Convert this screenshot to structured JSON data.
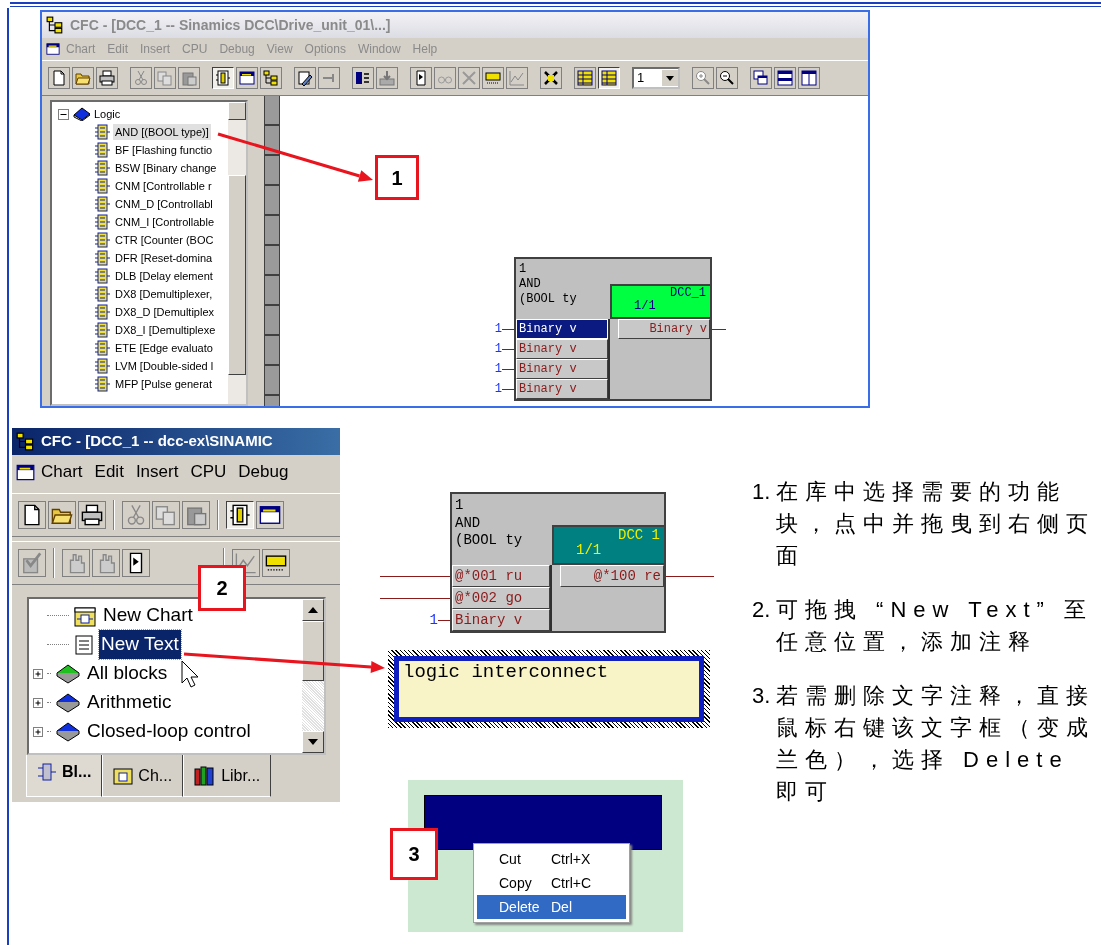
{
  "panel_1": {
    "callout": "1",
    "window": {
      "title": "CFC - [DCC_1 -- Sinamics DCC\\Drive_unit_01\\...]",
      "active": false,
      "menu": [
        "Chart",
        "Edit",
        "Insert",
        "CPU",
        "Debug",
        "View",
        "Options",
        "Window",
        "Help"
      ],
      "sheet_number": "1",
      "tree": {
        "label": "Logic",
        "expanded": true,
        "children": [
          {
            "label": "AND [(BOOL type)]",
            "selected": true
          },
          {
            "label": "BF [Flashing functio",
            "selected": false
          },
          {
            "label": "BSW [Binary change",
            "selected": false
          },
          {
            "label": "CNM [Controllable r",
            "selected": false
          },
          {
            "label": "CNM_D [Controllabl",
            "selected": false
          },
          {
            "label": "CNM_I [Controllable",
            "selected": false
          },
          {
            "label": "CTR [Counter (BOC",
            "selected": false
          },
          {
            "label": "DFR [Reset-domina",
            "selected": false
          },
          {
            "label": "DLB [Delay element",
            "selected": false
          },
          {
            "label": "DX8 [Demultiplexer,",
            "selected": false
          },
          {
            "label": "DX8_D [Demultiplex",
            "selected": false
          },
          {
            "label": "DX8_I [Demultiplexe",
            "selected": false
          },
          {
            "label": "ETE [Edge evaluato",
            "selected": false
          },
          {
            "label": "LVM [Double-sided l",
            "selected": false
          },
          {
            "label": "MFP [Pulse generat",
            "selected": false
          }
        ]
      },
      "block": {
        "number": "1",
        "name": "AND",
        "comment": "(BOOL ty",
        "task": "DCC_1",
        "sequence": "1/1",
        "color": "#00ff40",
        "inputs": [
          {
            "label": "Binary v",
            "kind": "constant",
            "value": "1",
            "selected": true
          },
          {
            "label": "Binary v",
            "kind": "constant",
            "value": "1",
            "selected": false
          },
          {
            "label": "Binary v",
            "kind": "constant",
            "value": "1",
            "selected": false
          },
          {
            "label": "Binary v",
            "kind": "constant",
            "value": "1",
            "selected": false
          }
        ],
        "outputs": [
          {
            "label": "Binary v",
            "kind": "wire",
            "selected": false
          }
        ]
      }
    }
  },
  "panel_2": {
    "callout": "2",
    "window": {
      "title": "CFC - [DCC_1 -- dcc-ex\\SINAMIC",
      "active": true,
      "menu": [
        "Chart",
        "Edit",
        "Insert",
        "CPU",
        "Debug"
      ],
      "tree": [
        {
          "label": "New Chart",
          "kind": "chart",
          "expandable": false,
          "selected": false
        },
        {
          "label": "New Text",
          "kind": "text",
          "expandable": false,
          "selected": true
        },
        {
          "label": "All blocks",
          "kind": "library",
          "color": "#20c020",
          "expandable": true,
          "selected": false
        },
        {
          "label": "Arithmetic",
          "kind": "library",
          "color": "#1030e0",
          "expandable": true,
          "selected": false
        },
        {
          "label": "Closed-loop control",
          "kind": "library",
          "color": "#1030e0",
          "expandable": true,
          "selected": false
        }
      ],
      "tabs": [
        {
          "label": "Bl...",
          "kind": "blocks",
          "selected": true
        },
        {
          "label": "Ch...",
          "kind": "charts",
          "selected": false
        },
        {
          "label": "Libr...",
          "kind": "libraries",
          "selected": false
        }
      ]
    },
    "block": {
      "number": "1",
      "name": "AND",
      "comment": "(BOOL ty",
      "task": "DCC 1",
      "sequence": "1/1",
      "color": "#008080",
      "inputs": [
        {
          "label": "@*001 ru",
          "kind": "wire",
          "selected": false
        },
        {
          "label": "@*002 go",
          "kind": "wire",
          "selected": false
        },
        {
          "label": "Binary v",
          "kind": "constant",
          "value": "1",
          "selected": false
        }
      ],
      "outputs": [
        {
          "label": "@*100 re",
          "kind": "wire",
          "selected": false
        }
      ]
    },
    "text_box": {
      "text": "logic interconnect",
      "selected": true
    }
  },
  "panel_3": {
    "callout": "3",
    "context_menu": [
      {
        "label": "Cut",
        "shortcut": "Ctrl+X",
        "selected": false
      },
      {
        "label": "Copy",
        "shortcut": "Ctrl+C",
        "selected": false
      },
      {
        "label": "Delete",
        "shortcut": "Del",
        "selected": true
      }
    ]
  },
  "instructions": [
    {
      "number": "1.",
      "text": "在库中选择需要的功能块，点中并拖曳到右侧页面"
    },
    {
      "number": "2.",
      "text": "可拖拽 “New Text” 至任意位置，添加注释"
    },
    {
      "number": "3.",
      "text": "若需删除文字注释，直接鼠标右键该文字框（变成兰色），选择 Delete 即可"
    }
  ]
}
